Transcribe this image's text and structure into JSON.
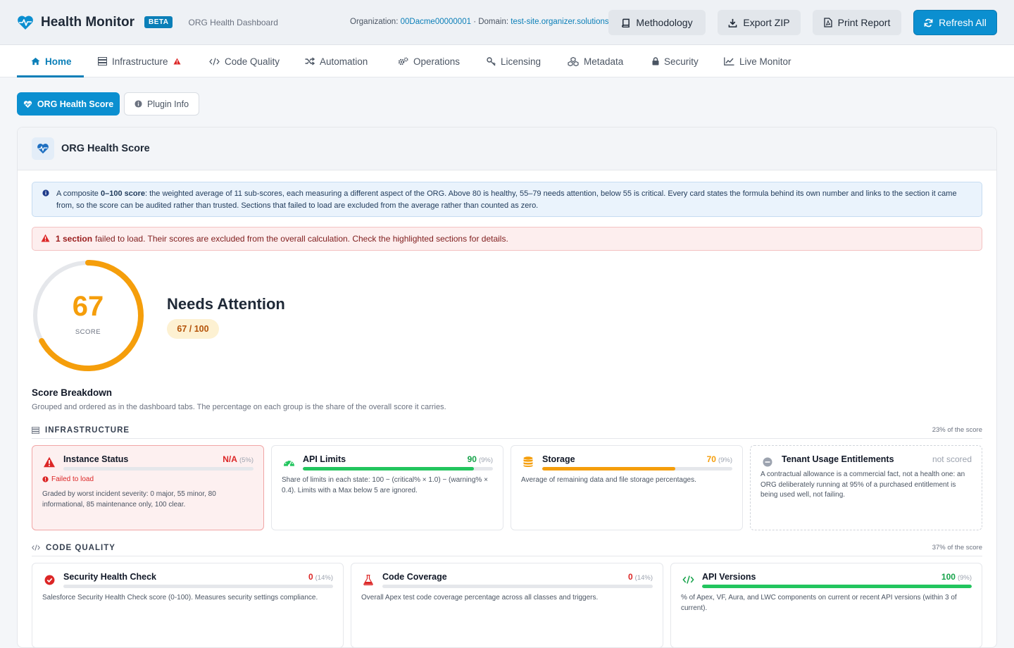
{
  "header": {
    "title": "Health Monitor",
    "badge": "BETA",
    "subtitle": "ORG Health Dashboard",
    "org_label": "Organization:",
    "org_id": "00Dacme00000001",
    "domain_label": "· Domain:",
    "domain": "test-site.organizer.solutions",
    "buttons": {
      "methodology": "Methodology",
      "export": "Export ZIP",
      "print": "Print Report",
      "refresh": "Refresh All"
    }
  },
  "nav": [
    {
      "label": "Home",
      "icon": "home-icon"
    },
    {
      "label": "Infrastructure",
      "icon": "server-icon",
      "warning": true
    },
    {
      "label": "Code Quality",
      "icon": "code-icon"
    },
    {
      "label": "Automation",
      "icon": "shuffle-icon"
    },
    {
      "label": "Operations",
      "icon": "gears-icon"
    },
    {
      "label": "Licensing",
      "icon": "key-icon"
    },
    {
      "label": "Metadata",
      "icon": "cubes-icon"
    },
    {
      "label": "Security",
      "icon": "lock-icon"
    },
    {
      "label": "Live Monitor",
      "icon": "line-chart-icon"
    }
  ],
  "subtabs": {
    "health": "ORG Health Score",
    "plugin": "Plugin Info"
  },
  "panel": {
    "title": "ORG Health Score",
    "info_lead": "A composite",
    "info_bold": "0–100 score",
    "info_text": ": the weighted average of 11 sub-scores, each measuring a different aspect of the ORG. Above 80 is healthy, 55–79 needs attention, below 55 is critical. Every card states the formula behind its own number and links to the section it came from, so the score can be audited rather than trusted. Sections that failed to load are excluded from the average rather than counted as zero.",
    "error_bold": "1 section",
    "error_text": "failed to load. Their scores are excluded from the overall calculation. Check the highlighted sections for details.",
    "score": 67,
    "score_label": "SCORE",
    "status": "Needs Attention",
    "score_pill": "67 / 100",
    "breakdown_title": "Score Breakdown",
    "breakdown_sub": "Grouped and ordered as in the dashboard tabs. The percentage on each group is the share of the overall score it carries."
  },
  "groups": {
    "infrastructure": {
      "name": "INFRASTRUCTURE",
      "share": "23% of the score"
    },
    "code_quality": {
      "name": "CODE QUALITY",
      "share": "37% of the score"
    }
  },
  "cards": {
    "instance_status": {
      "name": "Instance Status",
      "score": "N/A",
      "weight": "(5%)",
      "error": "Failed to load",
      "desc": "Graded by worst incident severity: 0 major, 55 minor, 80 informational, 85 maintenance only, 100 clear.",
      "value": 0,
      "color": "#dc2626"
    },
    "api_limits": {
      "name": "API Limits",
      "score": "90",
      "weight": "(9%)",
      "desc": "Share of limits in each state: 100 − (critical% × 1.0) − (warning% × 0.4). Limits with a Max below 5 are ignored.",
      "value": 90,
      "color": "#22c55e"
    },
    "storage": {
      "name": "Storage",
      "score": "70",
      "weight": "(9%)",
      "desc": "Average of remaining data and file storage percentages.",
      "value": 70,
      "color": "#f59e0b"
    },
    "tenant_usage": {
      "name": "Tenant Usage Entitlements",
      "score": "not scored",
      "desc": "A contractual allowance is a commercial fact, not a health one: an ORG deliberately running at 95% of a purchased entitlement is being used well, not failing."
    },
    "security_health": {
      "name": "Security Health Check",
      "score": "0",
      "weight": "(14%)",
      "desc": "Salesforce Security Health Check score (0-100). Measures security settings compliance.",
      "value": 0,
      "color": "#dc2626"
    },
    "code_coverage": {
      "name": "Code Coverage",
      "score": "0",
      "weight": "(14%)",
      "desc": "Overall Apex test code coverage percentage across all classes and triggers.",
      "value": 0,
      "color": "#dc2626"
    },
    "api_versions": {
      "name": "API Versions",
      "score": "100",
      "weight": "(9%)",
      "desc": "% of Apex, VF, Aura, and LWC components on current or recent API versions (within 3 of current).",
      "value": 100,
      "color": "#22c55e"
    }
  },
  "colors": {
    "accent": "#0b7fb8",
    "warning": "#f59e0b",
    "danger": "#dc2626",
    "success": "#22c55e"
  }
}
